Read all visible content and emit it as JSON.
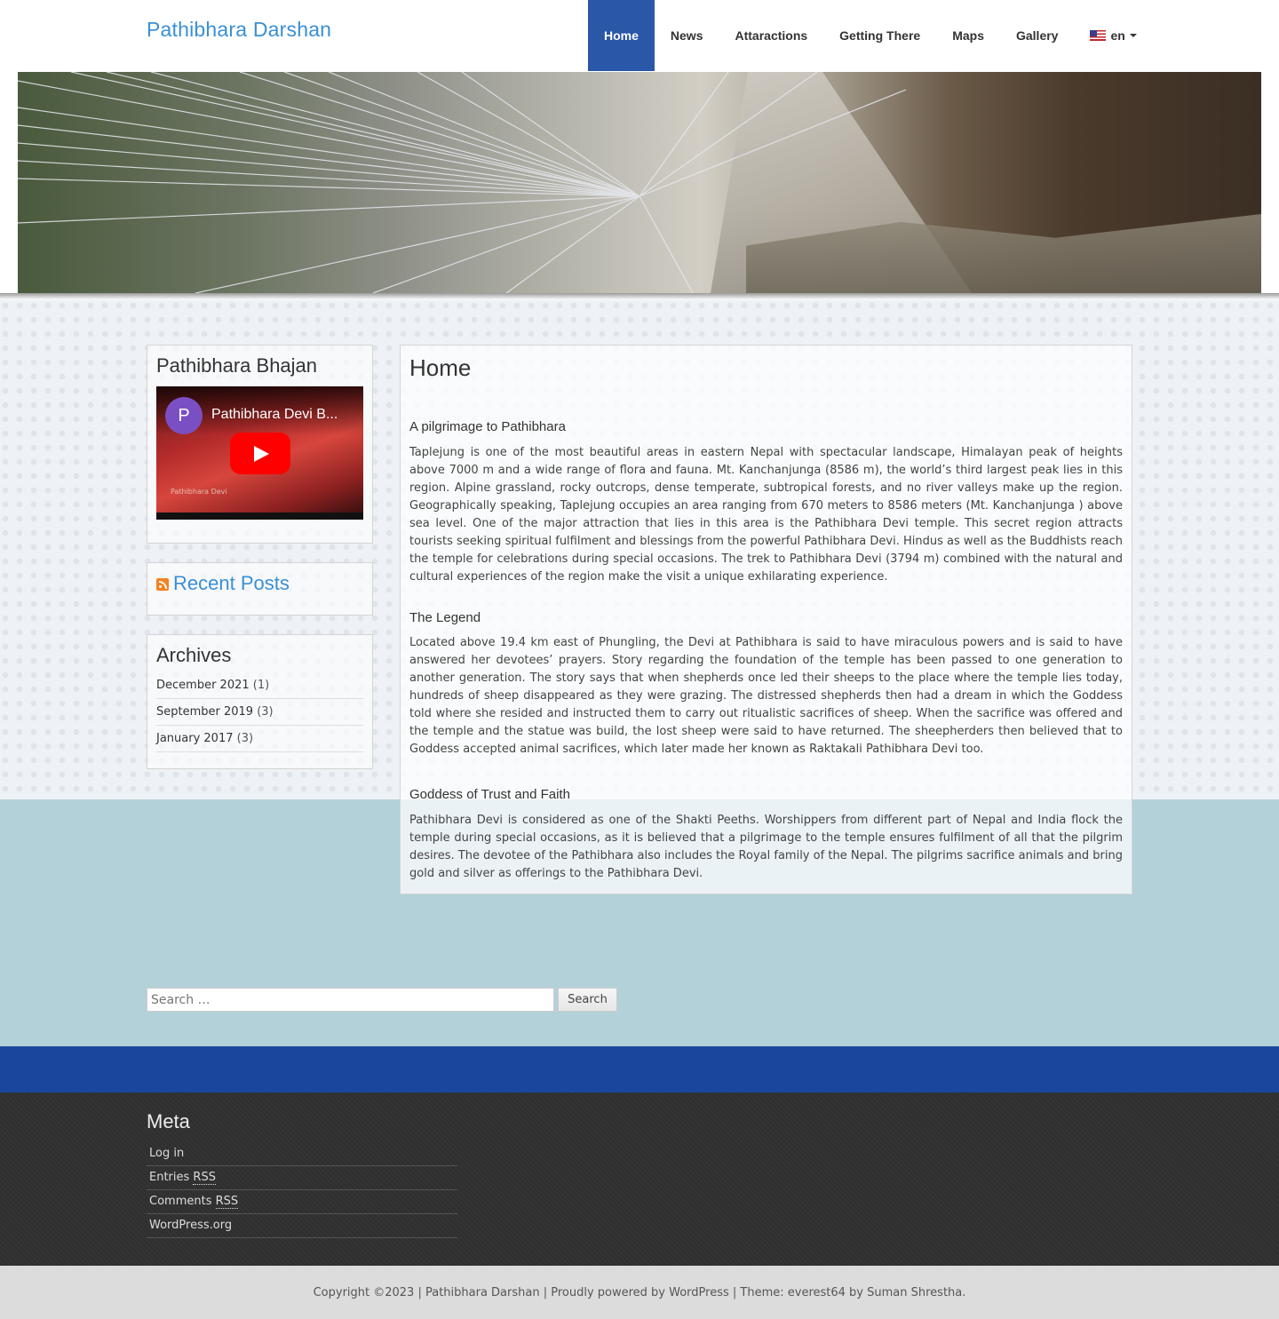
{
  "header": {
    "site_title": "Pathibhara Darshan",
    "nav": [
      {
        "label": "Home",
        "active": true
      },
      {
        "label": "News"
      },
      {
        "label": "Attaractions"
      },
      {
        "label": "Getting There"
      },
      {
        "label": "Maps"
      },
      {
        "label": "Gallery"
      }
    ],
    "language": "en"
  },
  "sidebar": {
    "bhajan": {
      "title": "Pathibhara Bhajan",
      "video_avatar": "P",
      "video_title": "Pathibhara Devi B...",
      "video_caption": "Pathibhara Devi"
    },
    "recent_posts_title": "Recent Posts",
    "archives": {
      "title": "Archives",
      "items": [
        {
          "label": "December 2021",
          "count": "(1)"
        },
        {
          "label": "September 2019",
          "count": "(3)"
        },
        {
          "label": "January 2017",
          "count": "(3)"
        }
      ]
    }
  },
  "content": {
    "title": "Home",
    "sections": [
      {
        "heading": "A pilgrimage to Pathibhara",
        "text": "Taplejung is one of the most beautiful areas in eastern Nepal with spectacular landscape, Himalayan peak of heights above 7000 m and a wide range of flora and fauna. Mt. Kanchanjunga (8586 m), the world’s third largest peak lies in this region. Alpine grassland, rocky outcrops, dense temperate, subtropical forests, and no river valleys make up the region. Geographically speaking, Taplejung occupies an area ranging from 670 meters to 8586 meters (Mt. Kanchanjunga ) above sea level. One of the major attraction that lies in this area is the Pathibhara Devi temple. This secret region attracts tourists seeking spiritual fulfilment and blessings from the powerful Pathibhara Devi. Hindus as well as the Buddhists reach the temple for celebrations during special occasions. The trek to Pathibhara Devi (3794 m) combined with the natural and cultural experiences of the region make the visit a unique exhilarating experience."
      },
      {
        "heading": "The Legend",
        "text": "Located above 19.4 km east of Phungling, the Devi at Pathibhara is said to have miraculous powers and is said to have answered her devotees’ prayers. Story regarding the foundation of the temple has been passed to one generation to another generation. The story says that when shepherds once led their sheeps to the place where the temple lies today, hundreds of sheep disappeared as they were grazing. The distressed shepherds then had a dream in which the Goddess told where she resided and instructed them to carry out ritualistic sacrifices of sheep. When the sacrifice was offered and the temple and the statue was build, the lost sheep were said to have returned. The sheepherders then believed that to Goddess accepted animal sacrifices, which later made her known as Raktakali Pathibhara Devi too."
      },
      {
        "heading": "Goddess of Trust and Faith",
        "text": "Pathibhara Devi is considered as one of the Shakti Peeths. Worshippers from different part of Nepal and India flock the temple during special occasions, as it is believed that a pilgrimage to the temple ensures fulfilment of all that the pilgrim desires. The devotee of the Pathibhara also includes the Royal family of the Nepal. The pilgrims sacrifice animals and bring gold and silver as offerings to the Pathibhara Devi."
      }
    ]
  },
  "search": {
    "placeholder": "Search …",
    "button_label": "Search"
  },
  "footer": {
    "meta_title": "Meta",
    "meta_items": [
      {
        "label": "Log in"
      },
      {
        "label": "Entries ",
        "abbr": "RSS"
      },
      {
        "label": "Comments ",
        "abbr": "RSS"
      },
      {
        "label": "WordPress.org"
      }
    ],
    "copyright": "Copyright ©2023 | Pathibhara Darshan | Proudly powered by WordPress | Theme: everest64 by Suman Shrestha."
  },
  "colors": {
    "brand_blue": "#3a8fd4",
    "nav_active": "#2b57a8",
    "blue_bar": "#1a469e",
    "lower_bg": "#b3d1d9",
    "footer_bg": "#2f2f2f"
  }
}
